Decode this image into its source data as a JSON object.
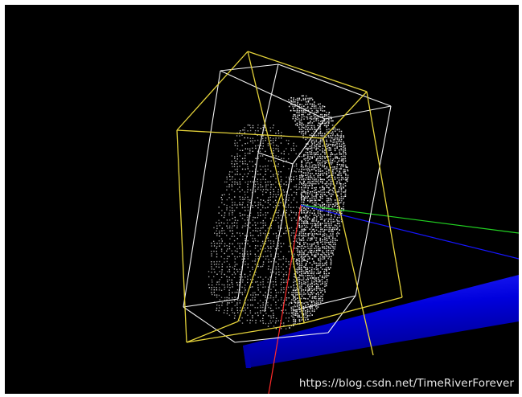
{
  "window": {
    "background_color": "#000000"
  },
  "scene": {
    "point_cloud": {
      "name": "point-cloud",
      "color": "#ffffff"
    },
    "bounding_boxes": [
      {
        "name": "aligned-bounding-box",
        "color": "#ffffff"
      },
      {
        "name": "oriented-bounding-box",
        "color": "#e5d33a"
      }
    ],
    "axes": [
      {
        "axis": "x",
        "color": "#ff2a2a"
      },
      {
        "axis": "y",
        "color": "#22d422"
      },
      {
        "axis": "z",
        "color": "#1616ff"
      }
    ],
    "cylinder": {
      "name": "axis-cylinder",
      "color": "#0000ee"
    }
  },
  "watermark": {
    "text": "https://blog.csdn.net/TimeRiverForever"
  }
}
